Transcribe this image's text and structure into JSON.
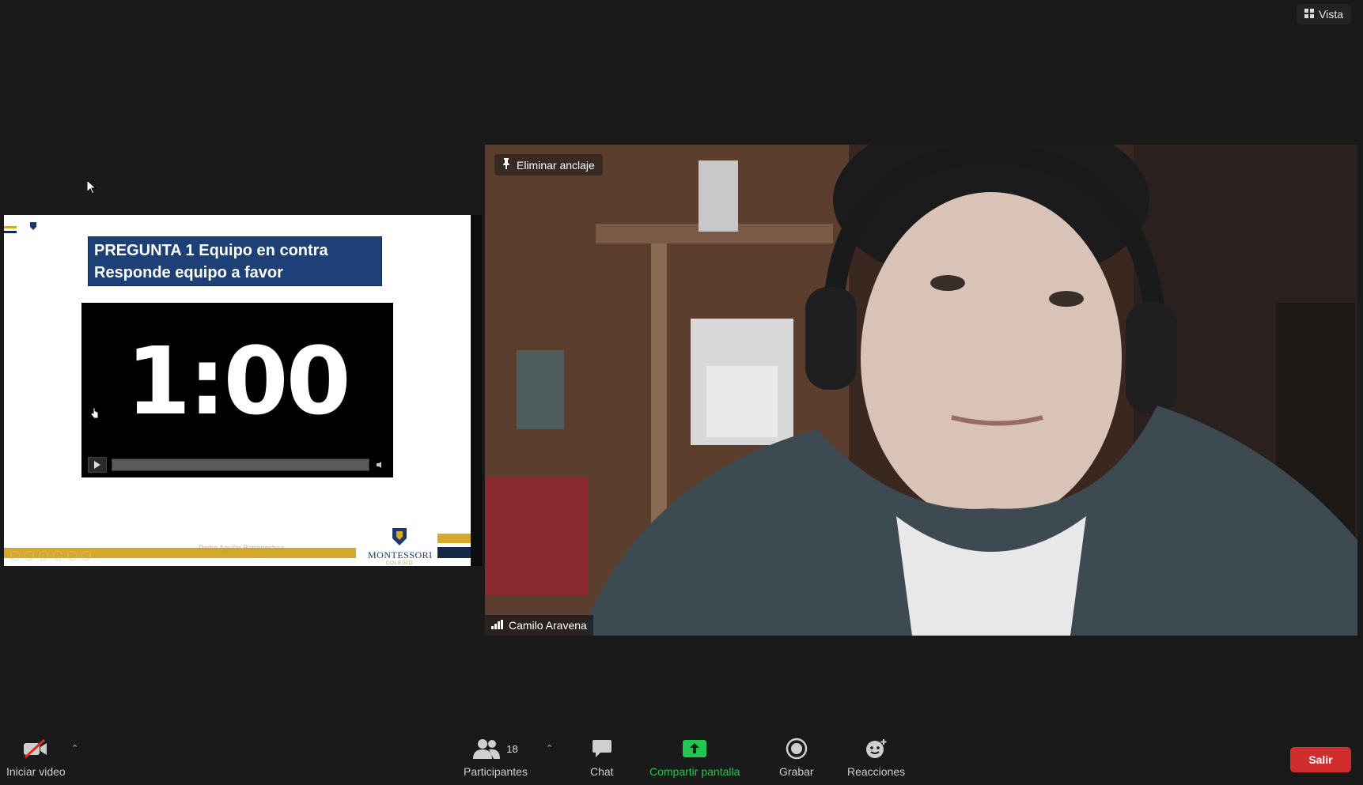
{
  "top_bar": {
    "view_label": "Vista",
    "view_icon": "grid-icon"
  },
  "slide": {
    "question_line1": "PREGUNTA 1 Equipo en contra",
    "question_line2": "Responde equipo a favor",
    "timer": "1:00",
    "footer_author": "Pedro Aguilar Barrenechea",
    "logo_name": "MONTESSORI",
    "logo_sub": "COLEGIO",
    "colors": {
      "navy": "#1d4077",
      "gold": "#d4a82a"
    }
  },
  "video": {
    "pin_label": "Eliminar anclaje",
    "participant_name": "Camilo Aravena"
  },
  "toolbar": {
    "start_video": "Iniciar video",
    "participants": "Participantes",
    "participants_count": "18",
    "chat": "Chat",
    "share_screen": "Compartir pantalla",
    "record": "Grabar",
    "reactions": "Reacciones",
    "leave": "Salir",
    "colors": {
      "share": "#23c552",
      "leave": "#d12d2d"
    }
  }
}
